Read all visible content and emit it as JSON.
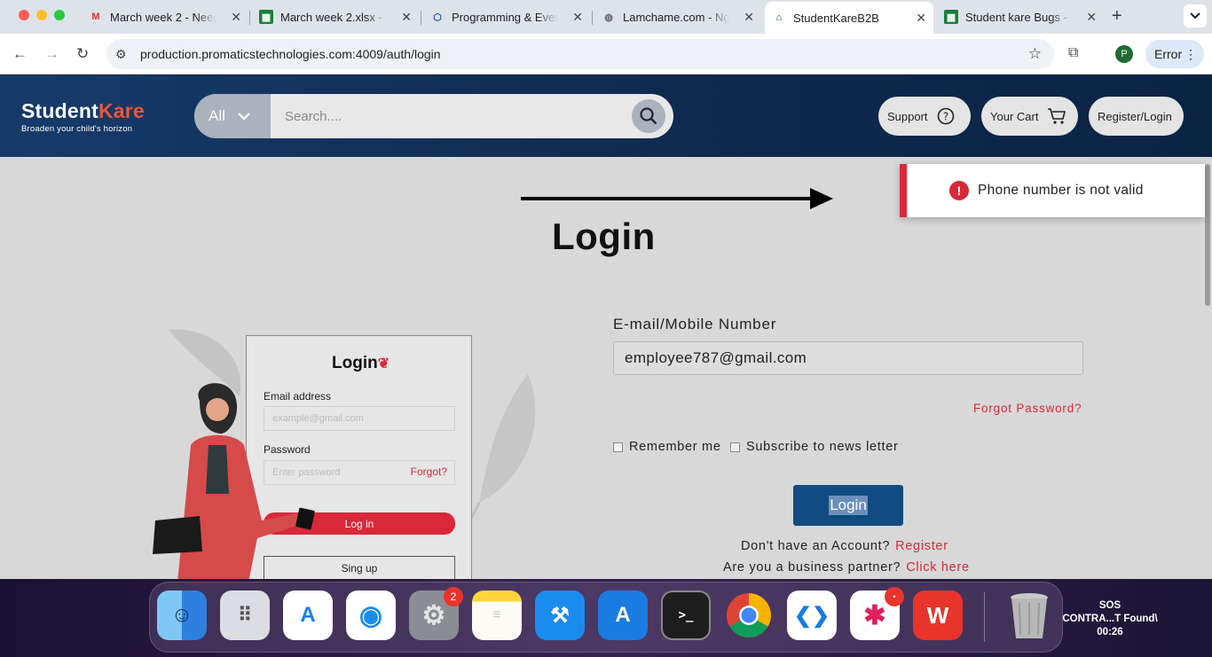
{
  "browser": {
    "tabs": [
      {
        "title": "March week 2 - Need",
        "icon": "gmail-icon"
      },
      {
        "title": "March week 2.xlsx - G",
        "icon": "sheets-icon"
      },
      {
        "title": "Programming & Event",
        "icon": "shield-icon"
      },
      {
        "title": "Lamchame.com - Ngu",
        "icon": "globe-icon"
      },
      {
        "title": "StudentKareB2B",
        "icon": "house-icon"
      },
      {
        "title": "Student kare Bugs - G",
        "icon": "sheets-icon"
      }
    ],
    "active_tab": 4,
    "url": "production.promaticstechnologies.com:4009/auth/login",
    "profile_initial": "P",
    "error_label": "Error"
  },
  "header": {
    "logo_main": "Student",
    "logo_accent": "Kare",
    "logo_tagline": "Broaden your child's horizon",
    "search_category": "All",
    "search_placeholder": "Search....",
    "support_label": "Support",
    "cart_label": "Your Cart",
    "register_label": "Register/Login"
  },
  "toast": {
    "message": "Phone number is not valid",
    "color": "#d8283a"
  },
  "page": {
    "title": "Login"
  },
  "illustration": {
    "card_title": "Login",
    "email_label": "Email address",
    "email_placeholder": "example@gmail.com",
    "password_label": "Password",
    "password_placeholder": "Enter password",
    "forgot": "Forgot?",
    "login_button": "Log in",
    "signup_button": "Sing up"
  },
  "form": {
    "email_label": "E-mail/Mobile Number",
    "email_value": "employee787@gmail.com",
    "forgot_password": "Forgot Password?",
    "remember_me": "Remember me",
    "subscribe": "Subscribe to news letter",
    "login_button": "Login",
    "no_account_text": "Don't have an Account?",
    "register_link": "Register",
    "partner_text": "Are you a business partner?",
    "partner_link": "Click here"
  },
  "dock": {
    "settings_badge": "2",
    "sos_line1": "SOS",
    "sos_line2": "CONTRA...T Found\\",
    "sos_time": "00:26"
  }
}
